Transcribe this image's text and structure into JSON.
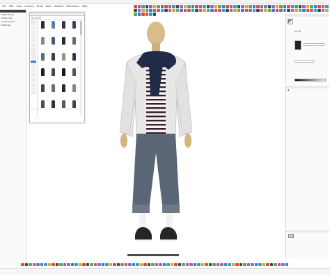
{
  "app": {
    "title": "",
    "menus": [
      "File",
      "Edit",
      "View",
      "Camera",
      "Draw",
      "Tools",
      "Window",
      "Extensions",
      "Help"
    ]
  },
  "left_panel": {
    "rows": [
      "Default Tray",
      "Entity Info",
      "Components",
      "Materials"
    ]
  },
  "library": {
    "title": "",
    "tabs": [
      "",
      "",
      ""
    ],
    "thumbnails": [
      {
        "label": "",
        "color": "#2d2d2d"
      },
      {
        "label": "",
        "color": "#5b7fa6"
      },
      {
        "label": "",
        "color": "#3a3a3a"
      },
      {
        "label": "",
        "color": "#34465c"
      },
      {
        "label": "",
        "color": "#8a8a8a"
      },
      {
        "label": "",
        "color": "#4b5d76"
      },
      {
        "label": "",
        "color": "#2c2c2c"
      },
      {
        "label": "",
        "color": "#6b6b6b"
      },
      {
        "label": "",
        "color": "#5e6b7a"
      },
      {
        "label": "",
        "color": "#3d3d3d"
      },
      {
        "label": "",
        "color": "#9a8f80"
      },
      {
        "label": "",
        "color": "#2f3a4a"
      },
      {
        "label": "",
        "color": "#1f1f1f"
      },
      {
        "label": "",
        "color": "#4a4a4a"
      },
      {
        "label": "",
        "color": "#1a1a1a"
      },
      {
        "label": "",
        "color": "#555555"
      },
      {
        "label": "",
        "color": "#3f4a3a"
      },
      {
        "label": "",
        "color": "#6d6d6d"
      },
      {
        "label": "",
        "color": "#2a2a2a"
      },
      {
        "label": "",
        "color": "#7c8794"
      },
      {
        "label": "",
        "color": "#4c4c4c"
      },
      {
        "label": "",
        "color": "#333333"
      },
      {
        "label": "",
        "color": "#5a5a5a"
      },
      {
        "label": "",
        "color": "#444444"
      }
    ],
    "info_lines": [
      "",
      "",
      "",
      ""
    ]
  },
  "right_panel": {
    "title": "",
    "tabs": [
      "",
      ""
    ],
    "labels": [
      "",
      "",
      ""
    ]
  },
  "layers_panel": {
    "title": "",
    "rows": [
      {
        "name": "",
        "color": "#3a3a3a"
      }
    ]
  },
  "props_panel": {
    "title": ""
  },
  "statusbar": {
    "left": "",
    "right": ""
  },
  "colors": {
    "accent": "#3b78d6",
    "skin": "#d8c08e",
    "jacket": "#e9e9e9",
    "scarf": "#1f2b47",
    "jeans": "#5a6674",
    "shoe": "#242424"
  }
}
